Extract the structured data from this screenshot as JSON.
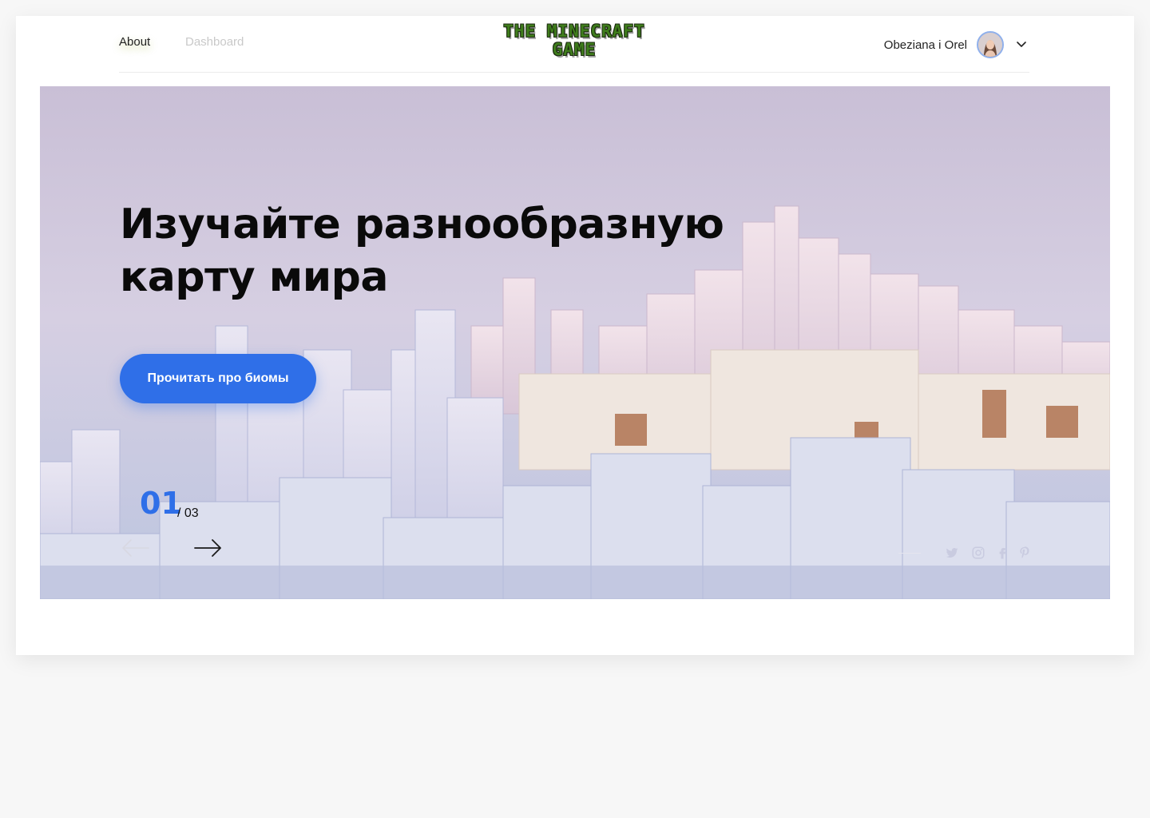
{
  "nav": {
    "about": "About",
    "dashboard": "Dashboard"
  },
  "logo": {
    "line1": "THE MINECRAFT",
    "line2": "GAME"
  },
  "user": {
    "name": "Obeziana i Orel",
    "avatar_icon": "avatar-photo",
    "menu_icon": "chevron-down-icon"
  },
  "hero": {
    "title": "Изучайте разнообразную\nкарту мира",
    "cta_label": "Прочитать про биомы"
  },
  "slider": {
    "current": "01",
    "total": "/ 03",
    "prev_icon": "arrow-left-icon",
    "next_icon": "arrow-right-icon"
  },
  "social": [
    "twitter-icon",
    "instagram-icon",
    "facebook-icon",
    "pinterest-icon"
  ],
  "colors": {
    "accent": "#2f6fe8",
    "logo_green": "#3f7d1c",
    "page_bg": "#f7f7f7"
  }
}
